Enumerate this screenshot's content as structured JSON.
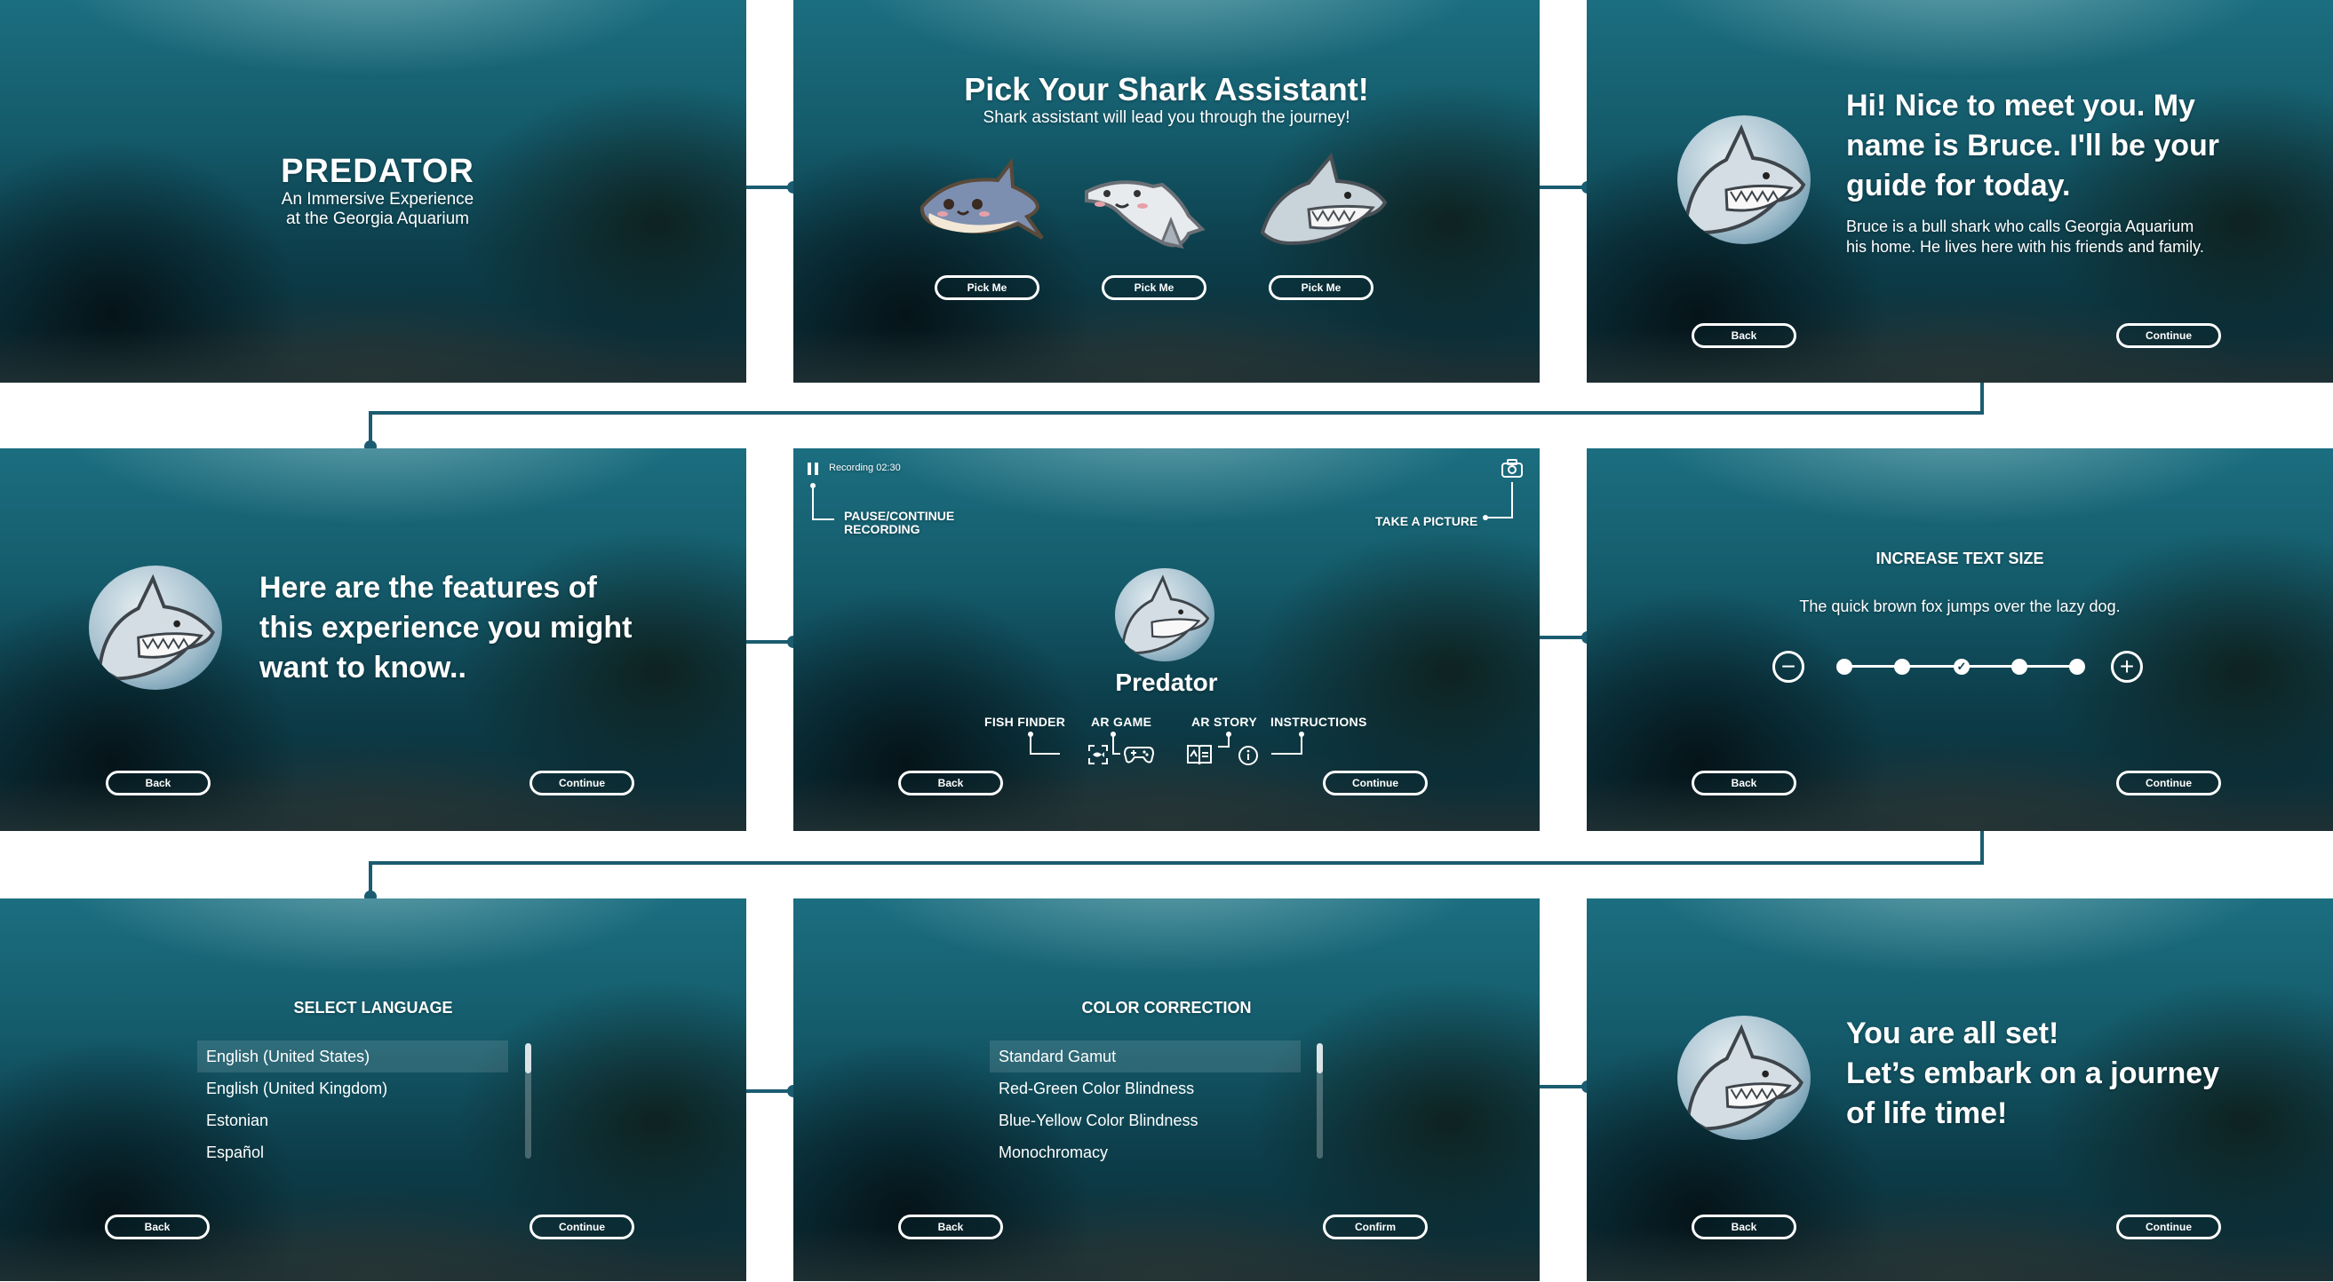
{
  "s1": {
    "title": "PREDATOR",
    "subtitle_1": "An Immersive Experience",
    "subtitle_2": "at the Georgia Aquarium"
  },
  "s2": {
    "title": "Pick Your Shark Assistant!",
    "subtitle": "Shark assistant will lead you through the journey!",
    "pick_label": "Pick Me"
  },
  "s3": {
    "greeting_1": "Hi! Nice to meet you. My",
    "greeting_2": "name is Bruce.  I'll be your",
    "greeting_3": "guide for today.",
    "bio_1": "Bruce is a bull shark who calls Georgia Aquarium",
    "bio_2": "his home. He lives here with his friends and family.",
    "back": "Back",
    "continue": "Continue"
  },
  "s4": {
    "line_1": "Here are the features of",
    "line_2": "this experience you might",
    "line_3": "want to know..",
    "back": "Back",
    "continue": "Continue"
  },
  "s5": {
    "recording": "Recording 02:30",
    "pause_1": "PAUSE/CONTINUE",
    "pause_2": "RECORDING",
    "take_picture": "TAKE A PICTURE",
    "title": "Predator",
    "features": [
      "FISH FINDER",
      "AR GAME",
      "AR STORY",
      "INSTRUCTIONS"
    ],
    "back": "Back",
    "continue": "Continue"
  },
  "s6": {
    "title": "INCREASE TEXT SIZE",
    "sample": "The quick brown fox jumps over the lazy dog.",
    "selected_step": 3,
    "step_count": 5,
    "back": "Back",
    "continue": "Continue"
  },
  "s7": {
    "title": "SELECT LANGUAGE",
    "options": [
      "English (United States)",
      "English (United Kingdom)",
      "Estonian",
      "Español"
    ],
    "back": "Back",
    "continue": "Continue"
  },
  "s8": {
    "title": "COLOR CORRECTION",
    "options": [
      "Standard Gamut",
      "Red-Green Color Blindness",
      "Blue-Yellow Color Blindness",
      "Monochromacy"
    ],
    "back": "Back",
    "confirm": "Confirm"
  },
  "s9": {
    "line_1": "You are all set!",
    "line_2": "Let’s embark on a journey",
    "line_3": "of life time!",
    "back": "Back",
    "continue": "Continue"
  },
  "colors": {
    "connector": "#1b5c70",
    "ocean_top": "#1b6e80",
    "ocean_bottom": "#0a2a33"
  }
}
